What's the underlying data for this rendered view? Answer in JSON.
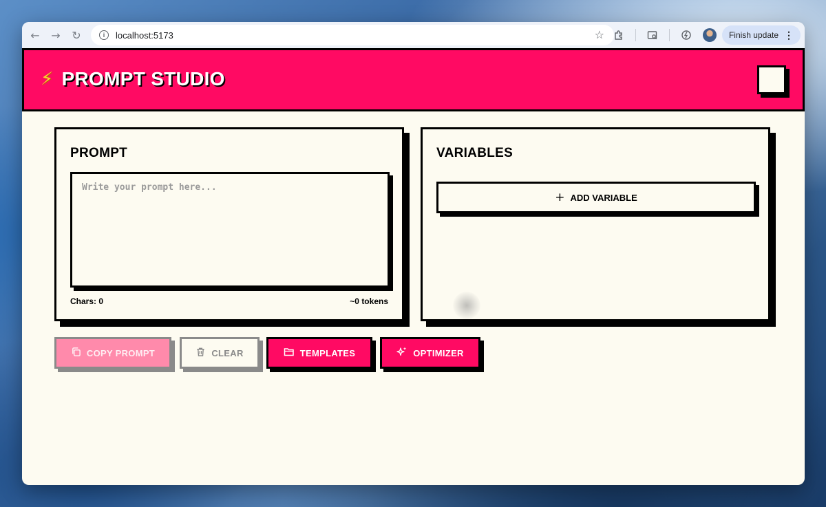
{
  "browser": {
    "url": "localhost:5173",
    "finish_update_label": "Finish update",
    "icons": {
      "back": "arrow-left-icon",
      "forward": "arrow-right-icon",
      "reload": "reload-icon",
      "info": "info-icon",
      "bookmark": "star-icon",
      "extensions": "puzzle-icon",
      "tab_search": "tab-search-icon",
      "performance": "leaf-icon",
      "menu": "kebab-icon"
    }
  },
  "header": {
    "title": "PROMPT STUDIO",
    "icon": "bolt-icon"
  },
  "prompt_panel": {
    "title": "PROMPT",
    "textarea": {
      "value": "",
      "placeholder": "Write your prompt here..."
    },
    "chars_label": "Chars: 0",
    "tokens_label": "~0 tokens"
  },
  "variables_panel": {
    "title": "VARIABLES",
    "add_button_label": "ADD VARIABLE"
  },
  "actions": {
    "copy_label": "COPY PROMPT",
    "clear_label": "CLEAR",
    "templates_label": "TEMPLATES",
    "optimizer_label": "OPTIMIZER"
  },
  "colors": {
    "accent": "#ff0a63",
    "background": "#fdfbf1",
    "border": "#000000",
    "disabled_accent": "#ff8aab",
    "disabled_border": "#8a8a8a"
  }
}
